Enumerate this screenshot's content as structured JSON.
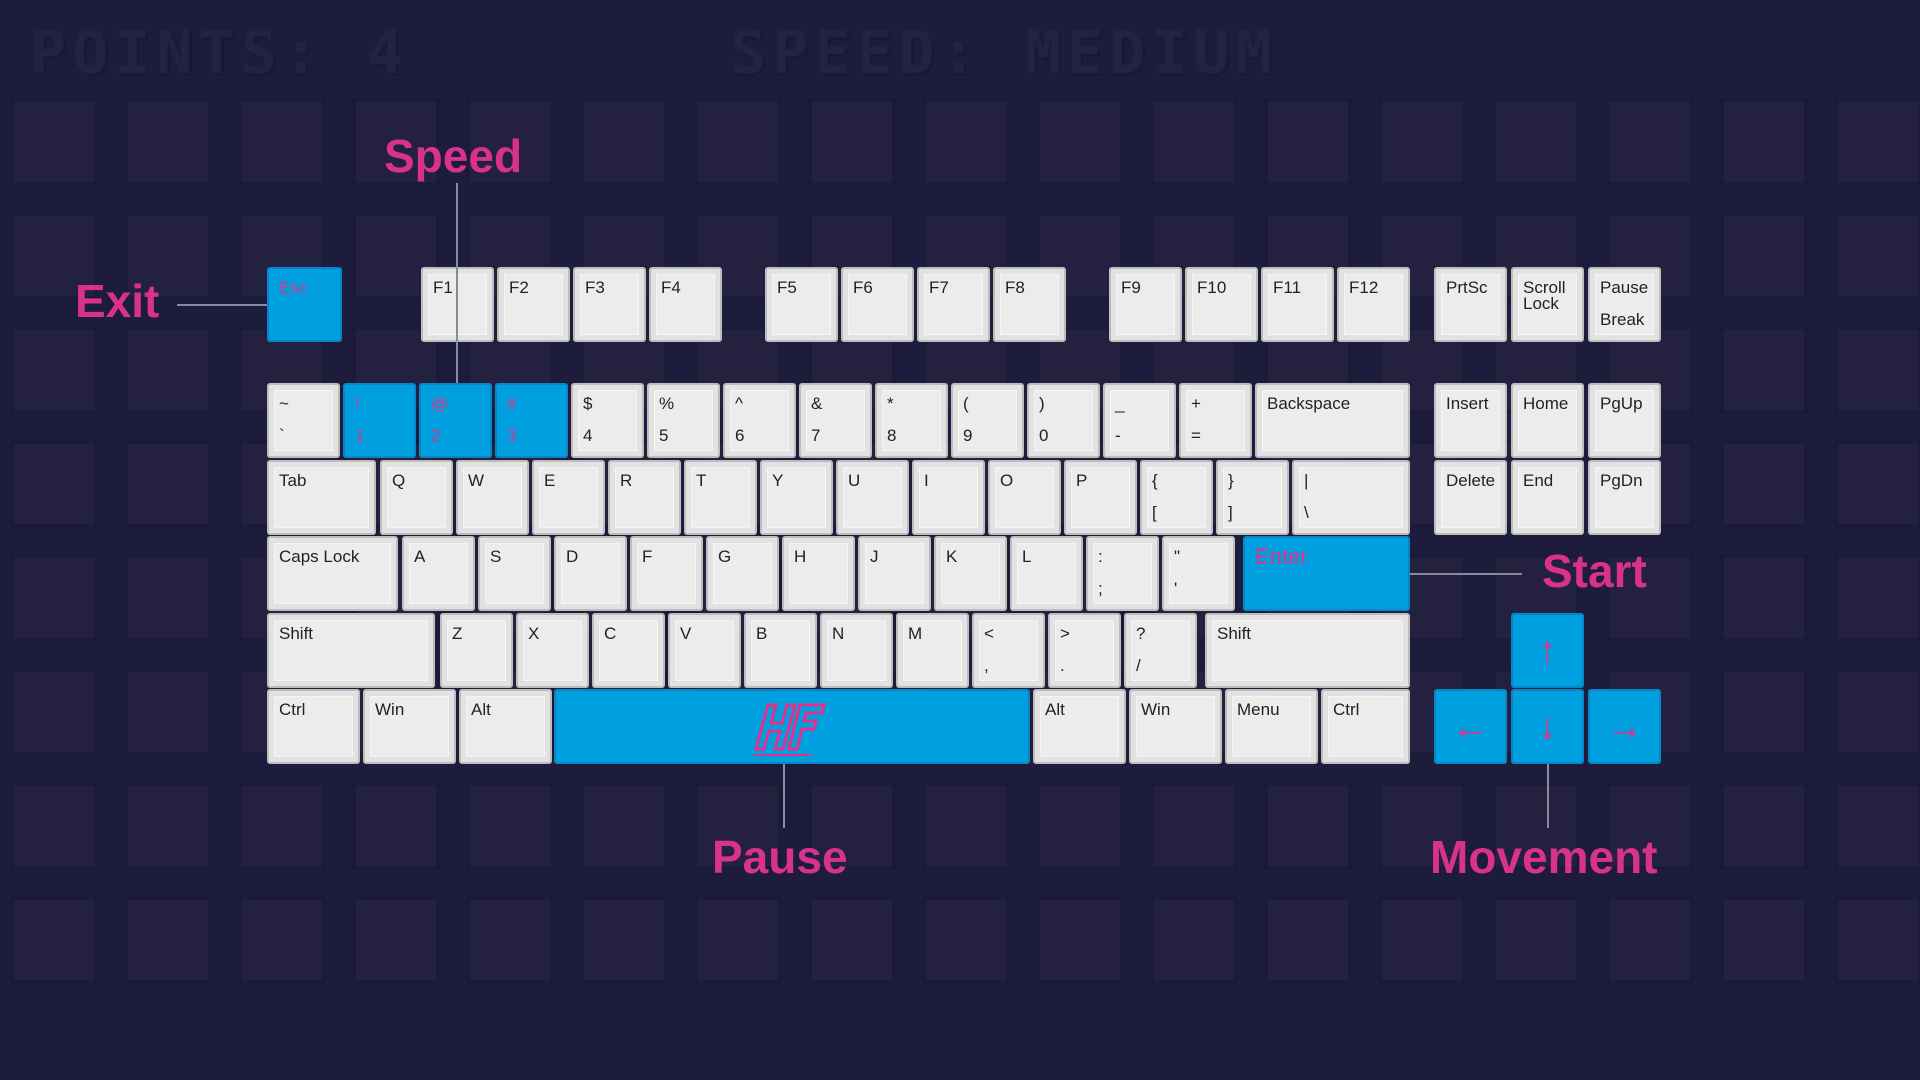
{
  "hud": {
    "points": "POINTS: 4",
    "speed": "SPEED: MEDIUM"
  },
  "colors": {
    "background": "#1e1c3d",
    "highlight": "#009fe0",
    "label": "#d9328e",
    "key": "#ececec"
  },
  "labels": {
    "exit": "Exit",
    "speed": "Speed",
    "start": "Start",
    "pause": "Pause",
    "movement": "Movement"
  },
  "keys": {
    "esc": "Esc",
    "f1": "F1",
    "f2": "F2",
    "f3": "F3",
    "f4": "F4",
    "f5": "F5",
    "f6": "F6",
    "f7": "F7",
    "f8": "F8",
    "f9": "F9",
    "f10": "F10",
    "f11": "F11",
    "f12": "F12",
    "prtsc": "PrtSc",
    "scroll_a": "Scroll",
    "scroll_b": "Lock",
    "pause_a": "Pause",
    "pause_b": "Break",
    "tilde_a": "~",
    "tilde_b": "`",
    "n1_a": "!",
    "n1_b": "1",
    "n2_a": "@",
    "n2_b": "2",
    "n3_a": "#",
    "n3_b": "3",
    "n4_a": "$",
    "n4_b": "4",
    "n5_a": "%",
    "n5_b": "5",
    "n6_a": "^",
    "n6_b": "6",
    "n7_a": "&",
    "n7_b": "7",
    "n8_a": "*",
    "n8_b": "8",
    "n9_a": "(",
    "n9_b": "9",
    "n0_a": ")",
    "n0_b": "0",
    "minus_a": "_",
    "minus_b": "-",
    "equal_a": "+",
    "equal_b": "=",
    "backspace": "Backspace",
    "insert": "Insert",
    "home": "Home",
    "pgup": "PgUp",
    "tab": "Tab",
    "q": "Q",
    "w": "W",
    "e": "E",
    "r": "R",
    "t": "T",
    "y": "Y",
    "u": "U",
    "i": "I",
    "o": "O",
    "p": "P",
    "lbracket_a": "{",
    "lbracket_b": "[",
    "rbracket_a": "}",
    "rbracket_b": "]",
    "backslash_a": "|",
    "backslash_b": "\\",
    "delete": "Delete",
    "end": "End",
    "pgdn": "PgDn",
    "capslock": "Caps Lock",
    "a": "A",
    "s": "S",
    "d": "D",
    "f": "F",
    "g": "G",
    "h": "H",
    "j": "J",
    "k": "K",
    "l": "L",
    "semicolon_a": ":",
    "semicolon_b": ";",
    "quote_a": "\"",
    "quote_b": "'",
    "enter": "Enter",
    "shift": "Shift",
    "z": "Z",
    "x": "X",
    "c": "C",
    "v": "V",
    "b": "B",
    "n": "N",
    "m": "M",
    "comma_a": "<",
    "comma_b": ",",
    "period_a": ">",
    "period_b": ".",
    "slash_a": "?",
    "slash_b": "/",
    "ctrl": "Ctrl",
    "win": "Win",
    "alt": "Alt",
    "menu": "Menu",
    "arrow_up": "↑",
    "arrow_left": "←",
    "arrow_down": "↓",
    "arrow_right": "→"
  }
}
